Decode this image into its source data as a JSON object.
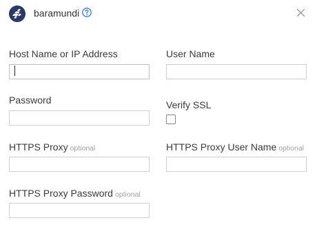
{
  "header": {
    "title": "baramundi",
    "logo_icon": "baramundi-fish-logo",
    "help_icon": "question-circle-icon",
    "close_icon": "close-x-icon",
    "accent_color": "#2b7de9",
    "logo_color": "#2b3a6b"
  },
  "form": {
    "host": {
      "label": "Host Name or IP Address",
      "value": "",
      "placeholder": "",
      "focused": true
    },
    "username": {
      "label": "User Name",
      "value": "",
      "placeholder": ""
    },
    "password": {
      "label": "Password",
      "value": "",
      "placeholder": ""
    },
    "verify_ssl": {
      "label": "Verify SSL",
      "checked": false
    },
    "https_proxy": {
      "label": "HTTPS Proxy",
      "optional": "optional",
      "value": "",
      "placeholder": ""
    },
    "https_proxy_user": {
      "label": "HTTPS Proxy User Name",
      "optional": "optional",
      "value": "",
      "placeholder": ""
    },
    "https_proxy_password": {
      "label": "HTTPS Proxy Password",
      "optional": "optional",
      "value": "",
      "placeholder": ""
    }
  }
}
